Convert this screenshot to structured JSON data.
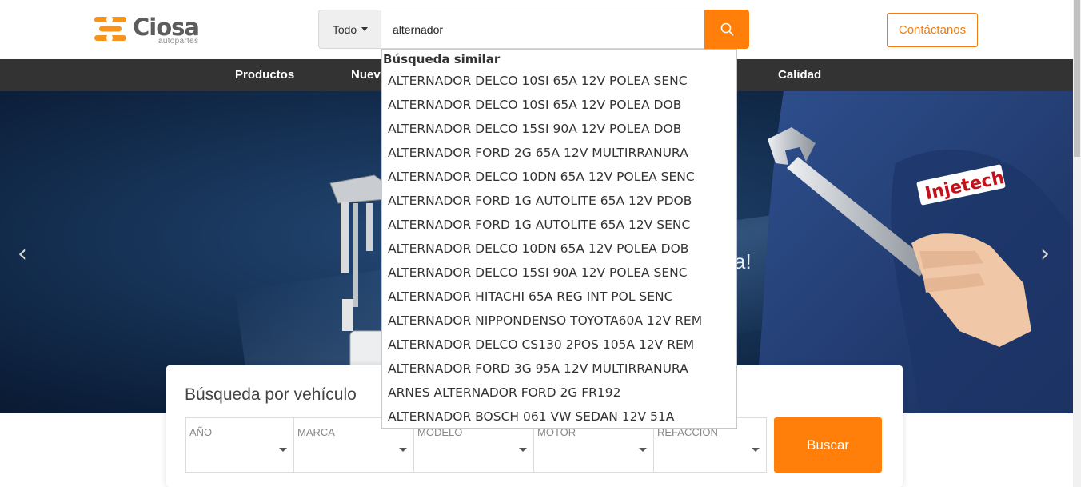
{
  "header": {
    "logo_text": "Ciosa",
    "logo_sub": "autopartes",
    "search": {
      "category": "Todo",
      "value": "alternador",
      "button_icon": "search-icon"
    },
    "contact_label": "Contáctanos"
  },
  "nav": {
    "items": [
      {
        "label": "Productos"
      },
      {
        "label": "Nuev"
      },
      {
        "label": "Calidad"
      }
    ]
  },
  "hero": {
    "tagline_tail": "a!",
    "brand": "Injetech",
    "prev_icon": "chevron-left-icon",
    "next_icon": "chevron-right-icon"
  },
  "vehicle_search": {
    "title": "Búsqueda por vehículo",
    "fields": [
      {
        "label": "AÑO"
      },
      {
        "label": "MARCA"
      },
      {
        "label": "MODELO"
      },
      {
        "label": "MOTOR"
      },
      {
        "label": "REFACCION"
      }
    ],
    "button_label": "Buscar"
  },
  "autocomplete": {
    "heading": "Búsqueda similar",
    "items": [
      "ALTERNADOR DELCO 10SI 65A 12V POLEA SENC",
      "ALTERNADOR DELCO 10SI 65A 12V POLEA DOB",
      "ALTERNADOR DELCO 15SI 90A 12V POLEA DOB",
      "ALTERNADOR FORD 2G 65A 12V MULTIRRANURA",
      "ALTERNADOR DELCO 10DN 65A 12V POLEA SENC",
      "ALTERNADOR FORD 1G AUTOLITE 65A 12V PDOB",
      "ALTERNADOR FORD 1G AUTOLITE 65A 12V SENC",
      "ALTERNADOR DELCO 10DN 65A 12V POLEA DOB",
      "ALTERNADOR DELCO 15SI 90A 12V POLEA SENC",
      "ALTERNADOR HITACHI 65A REG INT POL SENC",
      "ALTERNADOR NIPPONDENSO TOYOTA60A 12V REM",
      "ALTERNADOR DELCO CS130 2POS 105A 12V REM",
      "ALTERNADOR FORD 3G 95A 12V MULTIRRANURA",
      "ARNES ALTERNADOR FORD 2G FR192",
      "ALTERNADOR BOSCH 061 VW SEDAN 12V 51A"
    ]
  },
  "colors": {
    "accent": "#ff7f0a",
    "nav_bg": "#333333"
  }
}
